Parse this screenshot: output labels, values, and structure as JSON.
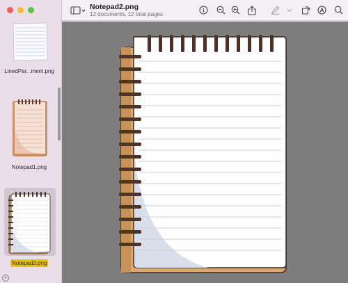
{
  "document": {
    "title": "Notepad2.png",
    "subtitle": "12 documents, 12 total pages"
  },
  "sidebar": {
    "items": [
      {
        "label": "LinedPar...ment.png",
        "selected": false
      },
      {
        "label": "Notepad1.png",
        "selected": false
      },
      {
        "label": "Notepad2.png",
        "selected": true
      }
    ],
    "add_label": "+"
  },
  "toolbar": {
    "icons": [
      "sidebar-toggle-icon",
      "chevron-down-icon",
      "info-icon",
      "zoom-out-icon",
      "zoom-in-icon",
      "share-icon",
      "highlight-pen-icon",
      "chevron-down-icon",
      "rotate-icon",
      "markup-icon",
      "search-icon"
    ]
  },
  "colors": {
    "close": "#ee5e56",
    "minimize": "#f4bd34",
    "zoom": "#5fc43e",
    "selection_label": "#e9c300",
    "canvas_bg": "#7d7d7d"
  }
}
